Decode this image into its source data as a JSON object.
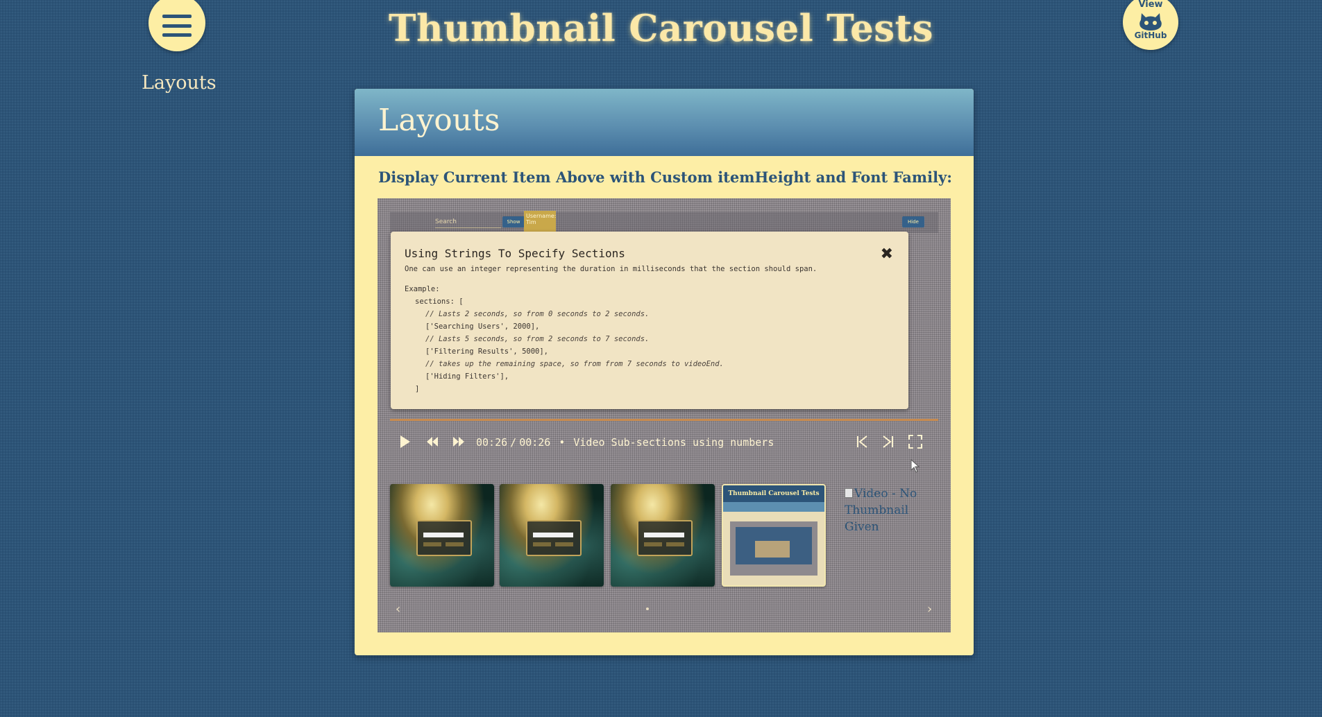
{
  "header": {
    "title": "Thumbnail Carousel Tests",
    "menu_icon": "hamburger-menu-icon",
    "github": {
      "top": "View",
      "bottom": "GitHub",
      "icon": "github-octocat-icon"
    }
  },
  "sidebar": {
    "nav_link": "Layouts"
  },
  "panel": {
    "title": "Layouts",
    "section_heading": "Display Current Item Above with Custom itemHeight and Font Family:"
  },
  "carousel": {
    "preview_strip": {
      "search_placeholder": "Search",
      "show_button": "Show",
      "user_label": "Username: Tim",
      "hide_button": "Hide"
    },
    "modal": {
      "title": "Using Strings To Specify Sections",
      "description": "One can use an integer representing the duration in milliseconds that the section should span.",
      "code": [
        "Example:",
        "sections: [",
        "// Lasts 2 seconds, so from 0 seconds to 2 seconds.",
        "['Searching Users', 2000],",
        "// Lasts 5 seconds, so from 2 seconds to 7 seconds.",
        "['Filtering Results', 5000],",
        "// takes up the remaining space, so from from 7 seconds to videoEnd.",
        "['Hiding Filters'],",
        "]"
      ],
      "close_icon": "close-x-icon"
    },
    "player": {
      "current_time": "00:26",
      "separator": "/",
      "duration": "00:26",
      "bullet": "•",
      "video_title": "Video Sub-sections using numbers",
      "progress_fraction": 1.0
    },
    "thumbnails": [
      {
        "kind": "nebula"
      },
      {
        "kind": "nebula"
      },
      {
        "kind": "nebula"
      },
      {
        "kind": "page",
        "label": "Thumbnail Carousel Tests"
      }
    ],
    "broken_thumbnail_alt": "Video - No Thumbnail Given",
    "colors": {
      "page_background": "#2c5478",
      "panel_background": "#fdeea6",
      "accent_yellow": "#fbe8a8",
      "progress": "#c68a4f"
    }
  }
}
